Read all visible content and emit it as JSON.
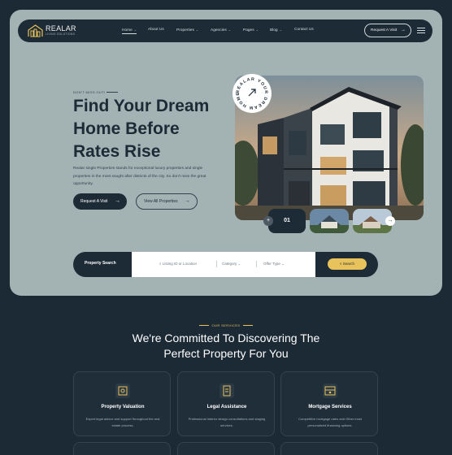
{
  "brand": {
    "name": "REALAR",
    "tagline": "LIVING SOLUTIONS"
  },
  "nav": {
    "items": [
      {
        "label": "Home",
        "dropdown": true
      },
      {
        "label": "About Us",
        "dropdown": false
      },
      {
        "label": "Properties",
        "dropdown": true
      },
      {
        "label": "Agencies",
        "dropdown": true
      },
      {
        "label": "Pages",
        "dropdown": true
      },
      {
        "label": "Blog",
        "dropdown": true
      },
      {
        "label": "Contact Us",
        "dropdown": false
      }
    ],
    "cta": "Request A Visit"
  },
  "hero": {
    "eyebrow": "DON'T MISS OUT!",
    "title_line1": "Find Your Dream",
    "title_line2": "Home Before",
    "title_line3": "Rates Rise",
    "description": "Realar single Properties stands for exceptional luxury properties and single properties in the most sought after districts of the city. So don't miss the great opportunity.",
    "primary_button": "Request A Visit",
    "secondary_button": "View All Properties",
    "badge_text": "REALAR YOUR DREAM HOME",
    "slide_number": "01"
  },
  "search": {
    "label": "Property Search",
    "listing_placeholder": "Listing ID or Location",
    "category": "Category",
    "offer_type": "Offer Type",
    "button": "Search"
  },
  "services": {
    "eyebrow": "OUR SERVICES",
    "title_line1": "We're Committed To Discovering The",
    "title_line2": "Perfect Property For You",
    "cards": [
      {
        "title": "Property Valuation",
        "description": "Expert legal advice and support throughout the real estate process."
      },
      {
        "title": "Legal Assistance",
        "description": "Professional interior design consultations and staging services."
      },
      {
        "title": "Mortgage Services",
        "description": "Competitive mortgage rates and Other most personalized financing options."
      }
    ]
  },
  "colors": {
    "hero_bg": "#a3b3b4",
    "dark": "#1d2b36",
    "accent": "#e8c25a",
    "page_bg": "#1c2a35"
  }
}
